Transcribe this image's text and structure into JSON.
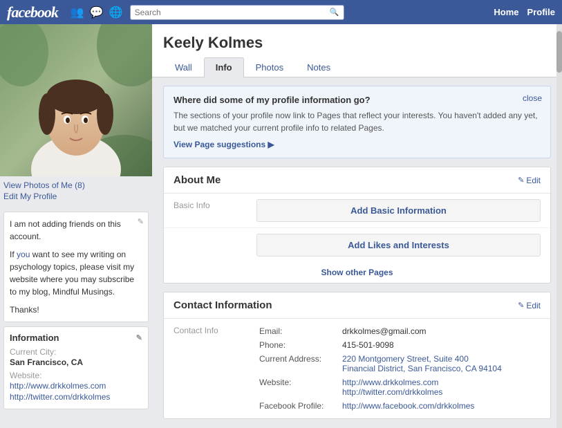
{
  "header": {
    "logo": "facebook",
    "search_placeholder": "Search",
    "nav_home": "Home",
    "nav_profile": "Profile",
    "icons": [
      "friends-icon",
      "messages-icon",
      "globe-icon"
    ]
  },
  "profile": {
    "name": "Keely Kolmes",
    "photo_alt": "Profile photo of Keely Kolmes",
    "photo_links": {
      "view_photos": "View Photos of Me (8)",
      "edit_profile": "Edit My Profile"
    },
    "tabs": [
      {
        "label": "Wall",
        "active": false
      },
      {
        "label": "Info",
        "active": true
      },
      {
        "label": "Photos",
        "active": false
      },
      {
        "label": "Notes",
        "active": false
      }
    ]
  },
  "sidebar": {
    "status_text_1": "I am not adding friends on this account.",
    "status_text_2": "If you want to see my writing on psychology topics, please visit my website where you may subscribe to my blog, Mindful Musings.",
    "status_text_3": "Thanks!",
    "status_link_text": "you",
    "info_header": "Information",
    "current_city_label": "Current City:",
    "current_city_value": "San Francisco, CA",
    "website_label": "Website:",
    "website_1": "http://www.drkkolmes.com",
    "website_2": "http://twitter.com/drkkolmes"
  },
  "banner": {
    "title": "Where did some of my profile information go?",
    "text": "The sections of your profile now link to Pages that reflect your interests. You haven't added any yet, but we matched your current profile info to related Pages.",
    "link_text": "View Page suggestions ▶",
    "close_text": "close"
  },
  "about_me": {
    "section_title": "About Me",
    "edit_label": "Edit",
    "basic_info_label": "Basic Info",
    "add_basic_info": "Add Basic Information",
    "add_likes": "Add Likes and Interests",
    "show_other_pages": "Show other Pages"
  },
  "contact_info": {
    "section_title": "Contact Information",
    "edit_label": "Edit",
    "contact_info_label": "Contact Info",
    "fields": [
      {
        "label": "Email:",
        "value": "drkkolmes@gmail.com",
        "is_link": false
      },
      {
        "label": "Phone:",
        "value": "415-501-9098",
        "is_link": false
      },
      {
        "label": "Current Address:",
        "value": "220 Montgomery Street, Suite 400",
        "value2": "Financial District, San Francisco, CA 94104",
        "is_link": false
      },
      {
        "label": "Website:",
        "value": "http://www.drkkolmes.com",
        "value2": "http://twitter.com/drkkolmes",
        "is_link": true
      },
      {
        "label": "Facebook Profile:",
        "value": "http://www.facebook.com/drkkolmes",
        "is_link": true
      }
    ]
  }
}
